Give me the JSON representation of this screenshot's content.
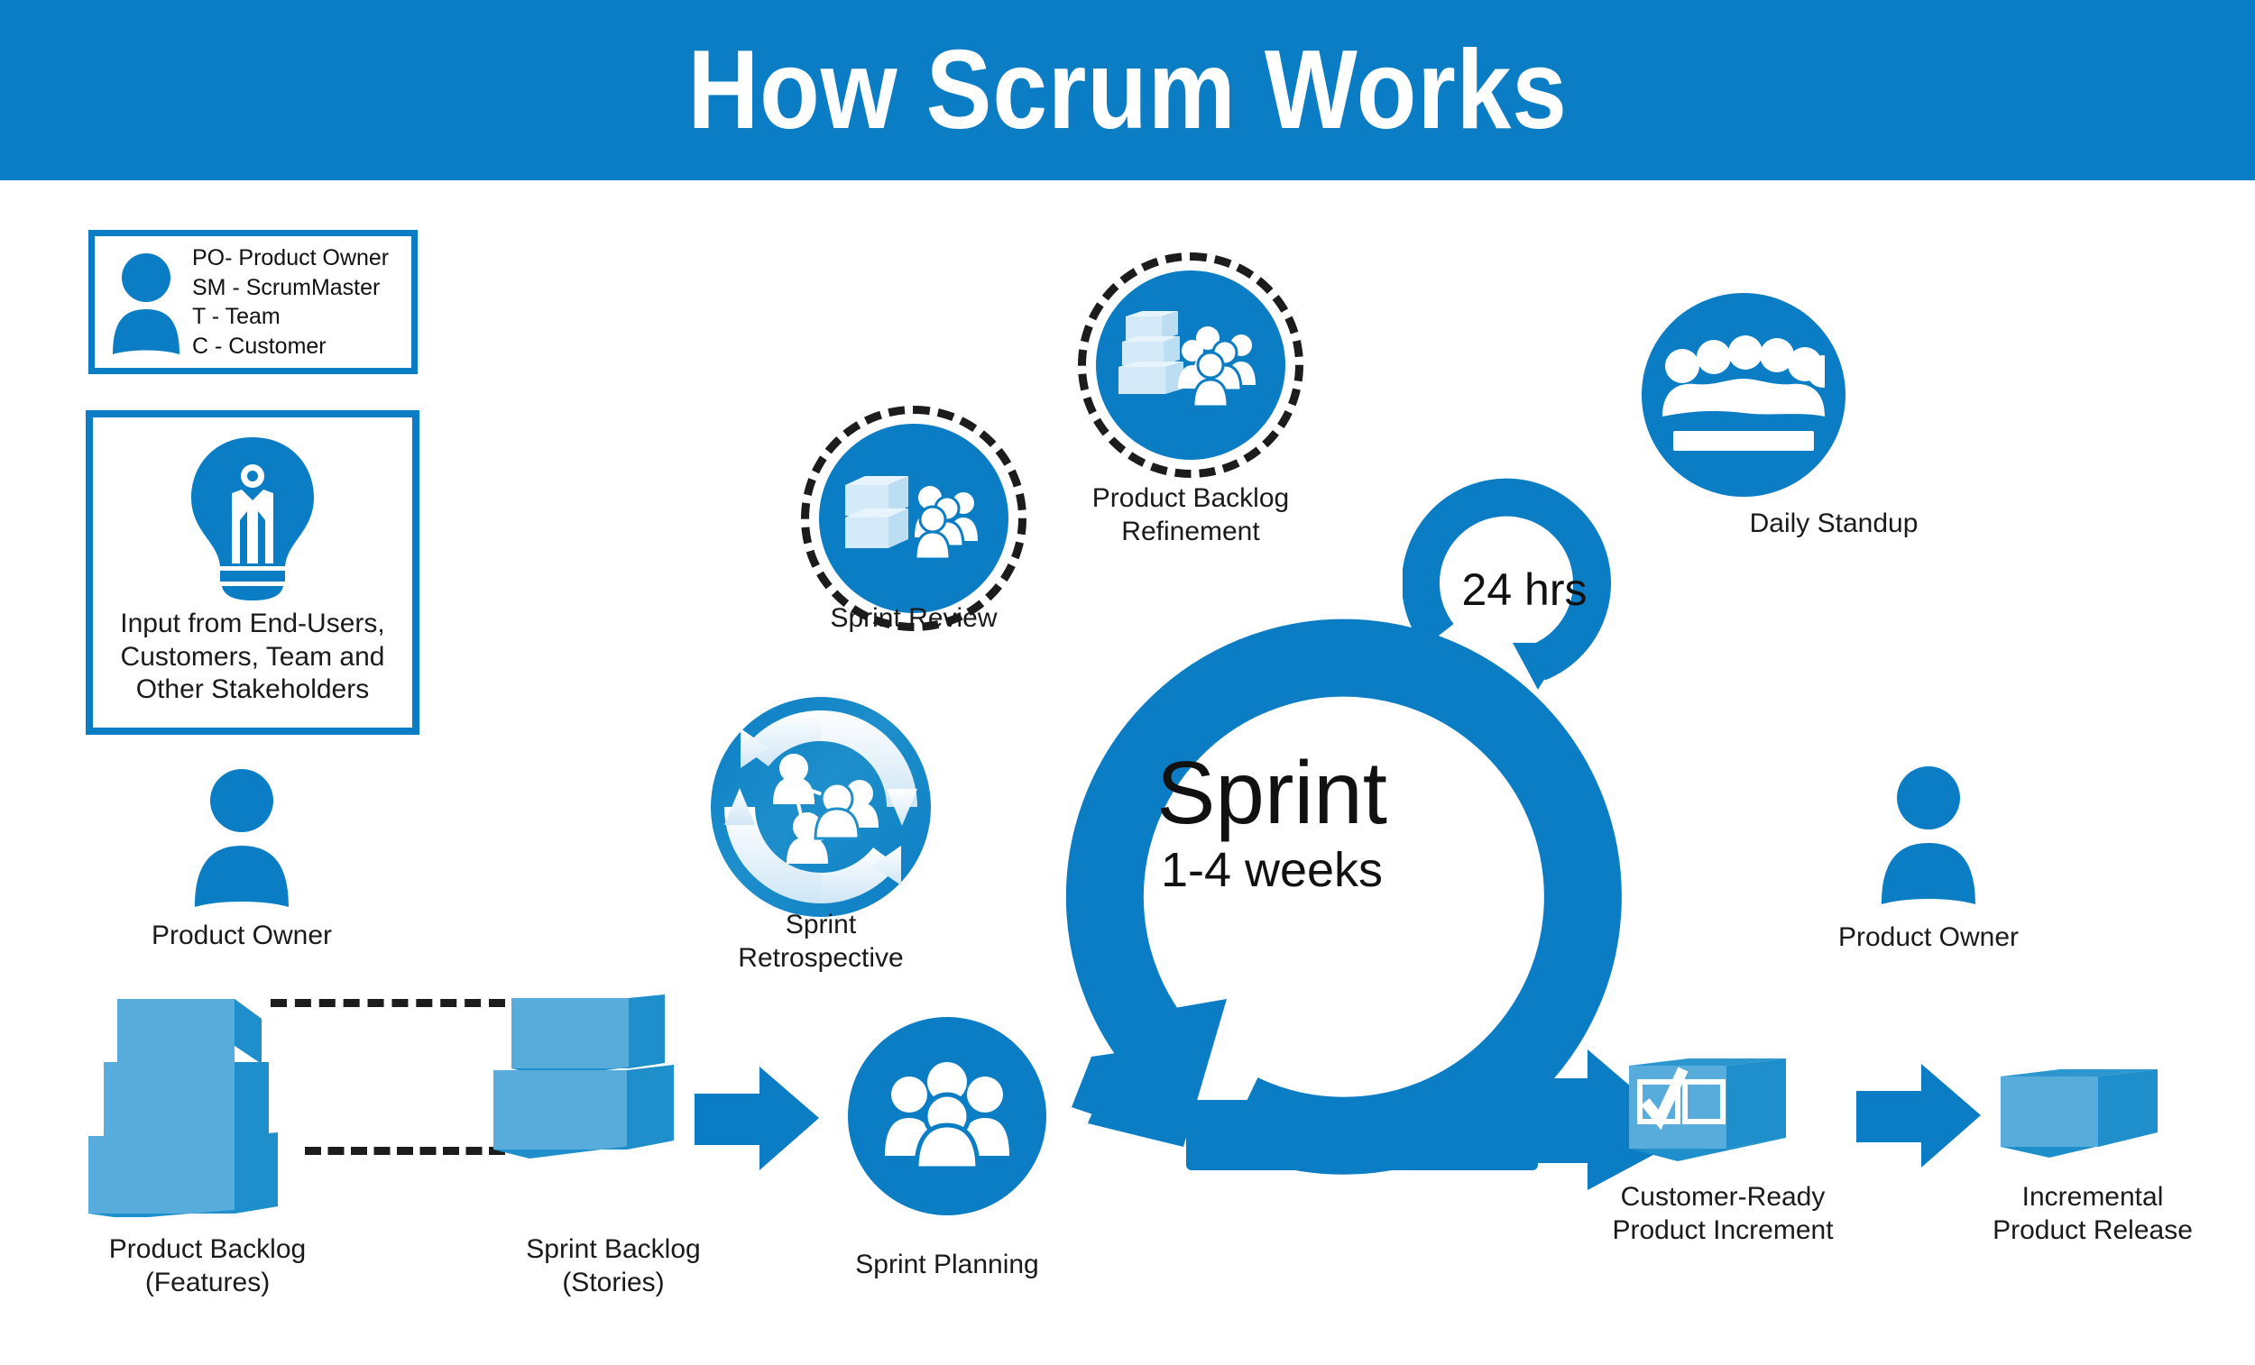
{
  "header": {
    "title": "How Scrum Works",
    "bg_color": "#0B7DC4"
  },
  "colors": {
    "primary_blue": "#0B7DC4",
    "light_box_blue": "#57ACDC",
    "dark_box_blue": "#1E8FCB",
    "dash_black": "#1c1c1c",
    "text": "#1a1a1a"
  },
  "legend": {
    "name": "role-abbreviations",
    "icon": "person-icon",
    "lines": "PO- Product Owner\nSM - ScrumMaster\nT - Team\nC -  Customer",
    "items": [
      {
        "abbr": "PO",
        "meaning": "Product Owner"
      },
      {
        "abbr": "SM",
        "meaning": "ScrumMaster"
      },
      {
        "abbr": "T",
        "meaning": "Team"
      },
      {
        "abbr": "C",
        "meaning": "Customer"
      }
    ]
  },
  "input_box": {
    "icon": "lightbulb-person-icon",
    "label": "Input from End-Users,\nCustomers, Team and\nOther Stakeholders"
  },
  "product_owner_left": {
    "icon": "person-icon",
    "label": "Product Owner"
  },
  "product_owner_right": {
    "icon": "person-icon",
    "label": "Product Owner"
  },
  "product_backlog": {
    "icon": "stacked-boxes-icon",
    "label": "Product Backlog\n(Features)",
    "box_count": 3
  },
  "sprint_backlog": {
    "icon": "stacked-boxes-icon",
    "label": "Sprint Backlog\n(Stories)",
    "box_count": 2
  },
  "sprint_planning": {
    "icon": "people-group-icon",
    "label": "Sprint Planning"
  },
  "sprint_retrospective": {
    "icon": "cycle-people-icon",
    "label": "Sprint\nRetrospective"
  },
  "sprint_review": {
    "icon": "boxes-people-icon",
    "label": "Sprint Review",
    "ring": "dashed"
  },
  "product_backlog_refinement": {
    "icon": "boxes-people-icon",
    "label": "Product Backlog\nRefinement",
    "ring": "dashed"
  },
  "daily_standup": {
    "icon": "team-table-icon",
    "label": "Daily Standup"
  },
  "sprint_cycle": {
    "title": "Sprint",
    "duration": "1-4 weeks",
    "daily_loop_label": "24 hrs"
  },
  "customer_ready_increment": {
    "icon": "checked-box-icon",
    "label": "Customer-Ready\nProduct Increment"
  },
  "incremental_release": {
    "icon": "box-icon",
    "label": "Incremental\nProduct Release"
  },
  "flow_arrows": [
    {
      "name": "arrow-sprint-backlog-to-planning"
    },
    {
      "name": "arrow-cycle-to-increment"
    },
    {
      "name": "arrow-increment-to-release"
    }
  ]
}
